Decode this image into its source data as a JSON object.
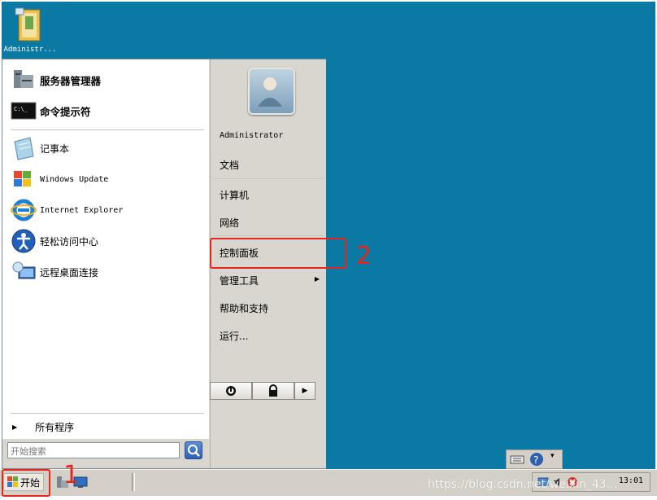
{
  "desktop": {
    "icons": [
      {
        "label": "Administr...",
        "icon": "folder-user-icon"
      }
    ]
  },
  "start_menu": {
    "pinned": [
      {
        "label": "服务器管理器",
        "icon": "server-manager-icon"
      },
      {
        "label": "命令提示符",
        "icon": "command-prompt-icon"
      }
    ],
    "recent": [
      {
        "label": "记事本",
        "icon": "notepad-icon"
      },
      {
        "label": "Windows Update",
        "icon": "windows-update-icon"
      },
      {
        "label": "Internet Explorer",
        "icon": "internet-explorer-icon"
      },
      {
        "label": "轻松访问中心",
        "icon": "ease-of-access-icon"
      },
      {
        "label": "远程桌面连接",
        "icon": "remote-desktop-icon"
      }
    ],
    "all_programs": "所有程序",
    "search_placeholder": "开始搜索",
    "right_items": {
      "user": "Administrator",
      "documents": "文档",
      "computer": "计算机",
      "network": "网络",
      "control_panel": "控制面板",
      "admin_tools": "管理工具",
      "help": "帮助和支持",
      "run": "运行..."
    },
    "power_icons": [
      "power-icon",
      "lock-icon",
      "arrow-right-icon"
    ]
  },
  "annotations": {
    "start_marker": "1",
    "control_panel_marker": "2"
  },
  "taskbar": {
    "start_label": "开始",
    "clock": "13:01"
  },
  "watermark": "https://blog.csdn.net/weixin_43...",
  "colors": {
    "desktop": "#0a7aa5",
    "highlight": "#e8251d"
  }
}
